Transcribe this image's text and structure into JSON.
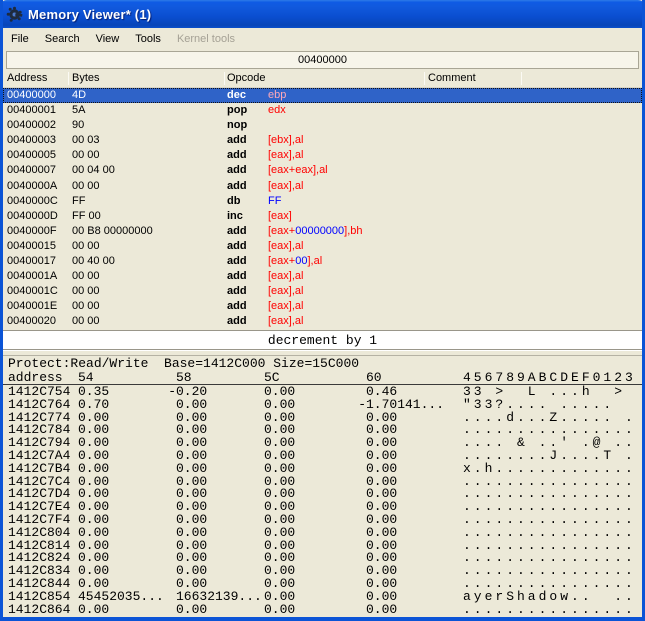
{
  "window": {
    "title": "Memory Viewer* (1)"
  },
  "menu": {
    "items": [
      {
        "label": "File",
        "enabled": true
      },
      {
        "label": "Search",
        "enabled": true
      },
      {
        "label": "View",
        "enabled": true
      },
      {
        "label": "Tools",
        "enabled": true
      },
      {
        "label": "Kernel tools",
        "enabled": false
      }
    ]
  },
  "address_bar": {
    "value": "00400000"
  },
  "disassembler": {
    "columns": [
      "Address",
      "Bytes",
      "Opcode",
      "Comment"
    ],
    "rows": [
      {
        "address": "00400000",
        "bytes": "4D",
        "opcode": "dec",
        "operand": [
          {
            "text": "ebp",
            "color": "selected_operand_pink"
          }
        ],
        "selected": true
      },
      {
        "address": "00400001",
        "bytes": "5A",
        "opcode": "pop",
        "operand": [
          {
            "text": "edx",
            "color": "operand_red"
          }
        ]
      },
      {
        "address": "00400002",
        "bytes": "90",
        "opcode": "nop",
        "operand": []
      },
      {
        "address": "00400003",
        "bytes": "00 03",
        "opcode": "add",
        "operand": [
          {
            "text": "[ebx],al",
            "color": "operand_red"
          }
        ]
      },
      {
        "address": "00400005",
        "bytes": "00 00",
        "opcode": "add",
        "operand": [
          {
            "text": "[eax],al",
            "color": "operand_red"
          }
        ]
      },
      {
        "address": "00400007",
        "bytes": "00 04 00",
        "opcode": "add",
        "operand": [
          {
            "text": "[eax+eax],al",
            "color": "operand_red"
          }
        ]
      },
      {
        "address": "0040000A",
        "bytes": "00 00",
        "opcode": "add",
        "operand": [
          {
            "text": "[eax],al",
            "color": "operand_red"
          }
        ]
      },
      {
        "address": "0040000C",
        "bytes": "FF",
        "opcode": "db",
        "operand": [
          {
            "text": "FF",
            "color": "operand_blue"
          }
        ]
      },
      {
        "address": "0040000D",
        "bytes": "FF 00",
        "opcode": "inc",
        "operand": [
          {
            "text": "[eax]",
            "color": "operand_red"
          }
        ]
      },
      {
        "address": "0040000F",
        "bytes": "00 B8 00000000",
        "opcode": "add",
        "operand": [
          {
            "text": "[eax+",
            "color": "operand_red"
          },
          {
            "text": "00000000",
            "color": "operand_blue"
          },
          {
            "text": "],bh",
            "color": "operand_red"
          }
        ]
      },
      {
        "address": "00400015",
        "bytes": "00 00",
        "opcode": "add",
        "operand": [
          {
            "text": "[eax],al",
            "color": "operand_red"
          }
        ]
      },
      {
        "address": "00400017",
        "bytes": "00 40 00",
        "opcode": "add",
        "operand": [
          {
            "text": "[eax+",
            "color": "operand_red"
          },
          {
            "text": "00",
            "color": "operand_blue"
          },
          {
            "text": "],al",
            "color": "operand_red"
          }
        ]
      },
      {
        "address": "0040001A",
        "bytes": "00 00",
        "opcode": "add",
        "operand": [
          {
            "text": "[eax],al",
            "color": "operand_red"
          }
        ]
      },
      {
        "address": "0040001C",
        "bytes": "00 00",
        "opcode": "add",
        "operand": [
          {
            "text": "[eax],al",
            "color": "operand_red"
          }
        ]
      },
      {
        "address": "0040001E",
        "bytes": "00 00",
        "opcode": "add",
        "operand": [
          {
            "text": "[eax],al",
            "color": "operand_red"
          }
        ]
      },
      {
        "address": "00400020",
        "bytes": "00 00",
        "opcode": "add",
        "operand": [
          {
            "text": "[eax],al",
            "color": "operand_red"
          }
        ]
      }
    ]
  },
  "comment_bar": {
    "text": "decrement by 1"
  },
  "hexview": {
    "info": "Protect:Read/Write  Base=1412C000 Size=15C000",
    "columns": [
      "address",
      "54",
      "58",
      "5C",
      "60",
      "456789ABCDEF0123"
    ],
    "rows": [
      {
        "address": "1412C754",
        "values": [
          "0.35",
          "-0.20",
          "0.00",
          "0.46"
        ],
        "ascii": "33 >  L ...h  >"
      },
      {
        "address": "1412C764",
        "values": [
          "0.70",
          "0.00",
          "0.00",
          "-1.70141..."
        ],
        "ascii": "\"33?.... ....."
      },
      {
        "address": "1412C774",
        "values": [
          "0.00",
          "0.00",
          "0.00",
          "0.00"
        ],
        "ascii": "....d...Z..... ."
      },
      {
        "address": "1412C784",
        "values": [
          "0.00",
          "0.00",
          "0.00",
          "0.00"
        ],
        "ascii": "................"
      },
      {
        "address": "1412C794",
        "values": [
          "0.00",
          "0.00",
          "0.00",
          "0.00"
        ],
        "ascii": ".... & ..' .@ .."
      },
      {
        "address": "1412C7A4",
        "values": [
          "0.00",
          "0.00",
          "0.00",
          "0.00"
        ],
        "ascii": "........J....T ."
      },
      {
        "address": "1412C7B4",
        "values": [
          "0.00",
          "0.00",
          "0.00",
          "0.00"
        ],
        "ascii": "x.h............."
      },
      {
        "address": "1412C7C4",
        "values": [
          "0.00",
          "0.00",
          "0.00",
          "0.00"
        ],
        "ascii": "................"
      },
      {
        "address": "1412C7D4",
        "values": [
          "0.00",
          "0.00",
          "0.00",
          "0.00"
        ],
        "ascii": "................"
      },
      {
        "address": "1412C7E4",
        "values": [
          "0.00",
          "0.00",
          "0.00",
          "0.00"
        ],
        "ascii": "................"
      },
      {
        "address": "1412C7F4",
        "values": [
          "0.00",
          "0.00",
          "0.00",
          "0.00"
        ],
        "ascii": "................"
      },
      {
        "address": "1412C804",
        "values": [
          "0.00",
          "0.00",
          "0.00",
          "0.00"
        ],
        "ascii": "................"
      },
      {
        "address": "1412C814",
        "values": [
          "0.00",
          "0.00",
          "0.00",
          "0.00"
        ],
        "ascii": "................"
      },
      {
        "address": "1412C824",
        "values": [
          "0.00",
          "0.00",
          "0.00",
          "0.00"
        ],
        "ascii": "................"
      },
      {
        "address": "1412C834",
        "values": [
          "0.00",
          "0.00",
          "0.00",
          "0.00"
        ],
        "ascii": "................"
      },
      {
        "address": "1412C844",
        "values": [
          "0.00",
          "0.00",
          "0.00",
          "0.00"
        ],
        "ascii": "................"
      },
      {
        "address": "1412C854",
        "values": [
          "45452035...",
          "16632139...",
          "0.00",
          "0.00"
        ],
        "ascii": "ayerShadow..  .."
      },
      {
        "address": "1412C864",
        "values": [
          "0.00",
          "0.00",
          "0.00",
          "0.00"
        ],
        "ascii": "................"
      }
    ]
  },
  "colors": {
    "operand_red": "#FF0000",
    "operand_blue": "#0000FF",
    "selected_operand_pink": "#FFA8B8",
    "selection_blue": "#2F63C8",
    "window_face": "#ECE9D8",
    "titlebar_blue": "#0B54D6"
  }
}
